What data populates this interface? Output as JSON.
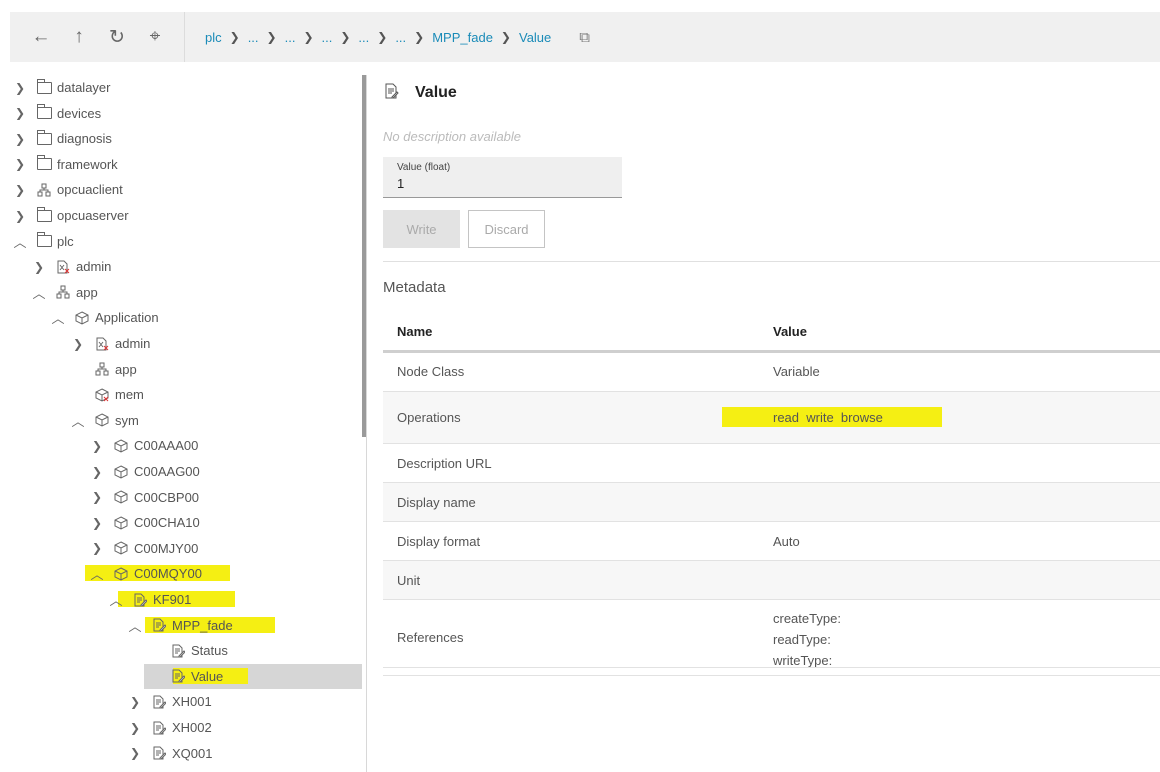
{
  "toolbar": {
    "back_icon": "←",
    "up_icon": "↑",
    "refresh_icon": "↻",
    "pin_icon": "⌖",
    "copy_icon": "⧉",
    "breadcrumbs": [
      "plc",
      "...",
      "...",
      "...",
      "...",
      "...",
      "MPP_fade",
      "Value"
    ]
  },
  "tree": {
    "items": [
      {
        "label": "datalayer",
        "icon": "folder-icon",
        "chevron": "right"
      },
      {
        "label": "devices",
        "icon": "folder-icon",
        "chevron": "right"
      },
      {
        "label": "diagnosis",
        "icon": "folder-icon",
        "chevron": "right"
      },
      {
        "label": "framework",
        "icon": "folder-icon",
        "chevron": "right"
      },
      {
        "label": "opcuaclient",
        "icon": "hierarchy-icon",
        "chevron": "right"
      },
      {
        "label": "opcuaserver",
        "icon": "folder-icon",
        "chevron": "right"
      },
      {
        "label": "plc",
        "icon": "folder-icon",
        "chevron": "down"
      },
      {
        "label": "admin",
        "icon": "file-x-icon",
        "chevron": "right"
      },
      {
        "label": "app",
        "icon": "hierarchy-icon",
        "chevron": "down"
      },
      {
        "label": "Application",
        "icon": "cube-icon",
        "chevron": "down"
      },
      {
        "label": "admin",
        "icon": "file-x-icon",
        "chevron": "right"
      },
      {
        "label": "app",
        "icon": "hierarchy-icon",
        "chevron": "none"
      },
      {
        "label": "mem",
        "icon": "cube-x-icon",
        "chevron": "none"
      },
      {
        "label": "sym",
        "icon": "cube-icon",
        "chevron": "down"
      },
      {
        "label": "C00AAA00",
        "icon": "cube-icon",
        "chevron": "right"
      },
      {
        "label": "C00AAG00",
        "icon": "cube-icon",
        "chevron": "right"
      },
      {
        "label": "C00CBP00",
        "icon": "cube-icon",
        "chevron": "right"
      },
      {
        "label": "C00CHA10",
        "icon": "cube-icon",
        "chevron": "right"
      },
      {
        "label": "C00MJY00",
        "icon": "cube-icon",
        "chevron": "right"
      },
      {
        "label": "C00MQY00",
        "icon": "cube-icon",
        "chevron": "down"
      },
      {
        "label": "KF901",
        "icon": "file-edit-icon",
        "chevron": "down"
      },
      {
        "label": "MPP_fade",
        "icon": "file-edit-icon",
        "chevron": "down"
      },
      {
        "label": "Status",
        "icon": "file-edit-icon",
        "chevron": "none"
      },
      {
        "label": "Value",
        "icon": "file-edit-icon",
        "chevron": "none"
      },
      {
        "label": "XH001",
        "icon": "file-edit-icon",
        "chevron": "right"
      },
      {
        "label": "XH002",
        "icon": "file-edit-icon",
        "chevron": "right"
      },
      {
        "label": "XQ001",
        "icon": "file-edit-icon",
        "chevron": "right"
      }
    ]
  },
  "detail": {
    "title": "Value",
    "description": "No description available",
    "value_label": "Value (float)",
    "value": "1",
    "write_label": "Write",
    "discard_label": "Discard",
    "metadata_title": "Metadata",
    "table": {
      "col_name": "Name",
      "col_value": "Value",
      "rows": [
        {
          "name": "Node Class",
          "value": "Variable"
        },
        {
          "name": "Operations",
          "value": "read  write  browse"
        },
        {
          "name": "Description URL",
          "value": ""
        },
        {
          "name": "Display name",
          "value": ""
        },
        {
          "name": "Display format",
          "value": "Auto"
        },
        {
          "name": "Unit",
          "value": ""
        },
        {
          "name": "References",
          "value": ""
        }
      ],
      "references": [
        "createType:",
        "readType:",
        "writeType:"
      ]
    }
  },
  "colors": {
    "highlight": "#f5ef13",
    "link": "#1a8bb8",
    "selected": "#d6d6d6"
  }
}
